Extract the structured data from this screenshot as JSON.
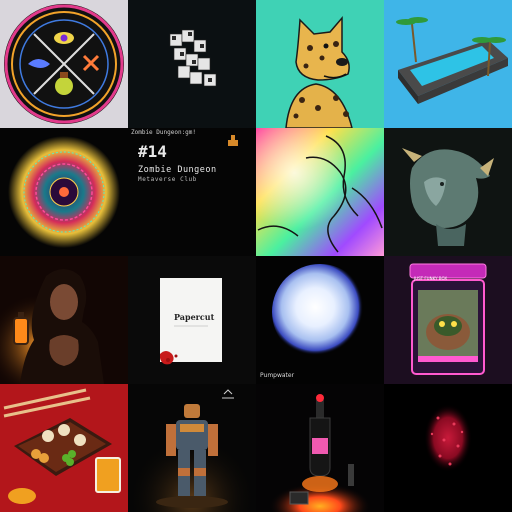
{
  "gallery": {
    "tiles": [
      {
        "name": "occult-seal-badge",
        "caption": ""
      },
      {
        "name": "voxel-block-sculpture",
        "caption": ""
      },
      {
        "name": "leopard-dog-portrait",
        "caption": ""
      },
      {
        "name": "pool-island-render",
        "caption": ""
      },
      {
        "name": "psychedelic-mandala",
        "caption": ""
      },
      {
        "name": "zombie-dungeon-card",
        "caption": "Zombie Dungeon:gm!",
        "number": "#14",
        "title": "Zombie Dungeon",
        "subtitle": "Metaverse Club"
      },
      {
        "name": "gradient-lines-abstract",
        "caption": ""
      },
      {
        "name": "stone-dragon-bust",
        "caption": ""
      },
      {
        "name": "lantern-woman-portrait",
        "caption": ""
      },
      {
        "name": "papercut-page",
        "label": "Papercut"
      },
      {
        "name": "glowing-orb",
        "caption": "Pumpwater"
      },
      {
        "name": "pinball-machine",
        "caption": "JUST FUNKY BOX"
      },
      {
        "name": "bento-box-illustration",
        "caption": ""
      },
      {
        "name": "armored-robot-figure",
        "caption": ""
      },
      {
        "name": "neon-bottle-scene",
        "caption": ""
      },
      {
        "name": "red-particle-cloud",
        "caption": ""
      }
    ]
  },
  "colors": {
    "teal": "#3fd2b5",
    "sky": "#3fb5e8",
    "bento_red": "#b3161b"
  }
}
